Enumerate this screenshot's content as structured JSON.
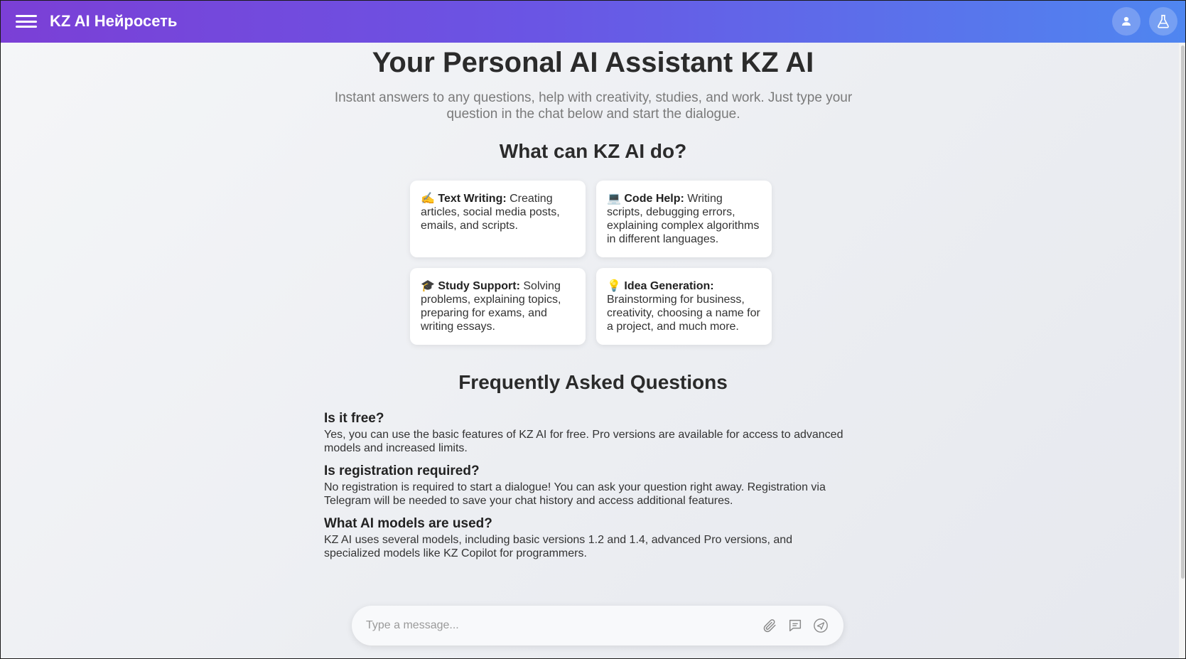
{
  "header": {
    "brand": "KZ AI Нейросеть"
  },
  "hero": {
    "title": "Your Personal AI Assistant KZ AI",
    "subtitle": "Instant answers to any questions, help with creativity, studies, and work. Just type your question in the chat below and start the dialogue."
  },
  "features": {
    "title": "What can KZ AI do?",
    "cards": [
      {
        "emoji": "✍️",
        "title": "Text Writing:",
        "text": " Creating articles, social media posts, emails, and scripts."
      },
      {
        "emoji": "💻",
        "title": "Code Help:",
        "text": " Writing scripts, debugging errors, explaining complex algorithms in different languages."
      },
      {
        "emoji": "🎓",
        "title": "Study Support:",
        "text": " Solving problems, explaining topics, preparing for exams, and writing essays."
      },
      {
        "emoji": "💡",
        "title": "Idea Generation:",
        "text": " Brainstorming for business, creativity, choosing a name for a project, and much more."
      }
    ]
  },
  "faq": {
    "title": "Frequently Asked Questions",
    "items": [
      {
        "q": "Is it free?",
        "a": "Yes, you can use the basic features of KZ AI for free. Pro versions are available for access to advanced models and increased limits."
      },
      {
        "q": "Is registration required?",
        "a": "No registration is required to start a dialogue! You can ask your question right away. Registration via Telegram will be needed to save your chat history and access additional features."
      },
      {
        "q": "What AI models are used?",
        "a": "KZ AI uses several models, including basic versions 1.2 and 1.4, advanced Pro versions, and specialized models like KZ Copilot for programmers."
      }
    ]
  },
  "composer": {
    "placeholder": "Type a message..."
  },
  "icons": {
    "menu": "hamburger-icon",
    "profile": "user-icon",
    "lab": "flask-icon",
    "attach": "paperclip-icon",
    "prompts": "chat-bubble-icon",
    "send": "send-icon"
  },
  "colors": {
    "header_start": "#7b3fd6",
    "header_end": "#4f86f0"
  }
}
